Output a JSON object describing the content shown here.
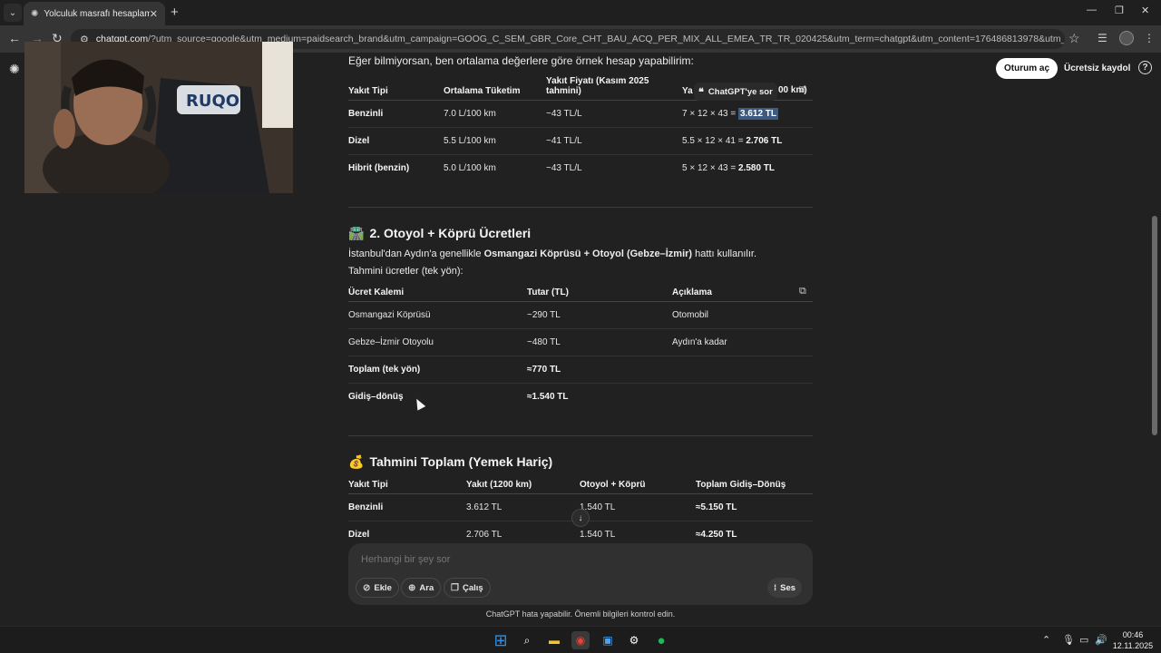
{
  "browser": {
    "tab_title": "Yolculuk masrafı hesaplama",
    "url_host": "chatgpt.com",
    "url_rest": "/?utm_source=google&utm_medium=paidsearch_brand&utm_campaign=GOOG_C_SEM_GBR_Core_CHT_BAU_ACQ_PER_MIX_ALL_EMEA_TR_TR_020425&utm_term=chatgpt&utm_content=176486813978&utm_ad=742246137488&utm_match=e..."
  },
  "header": {
    "login_label": "Oturum aç",
    "signup_label": "Ücretsiz kaydol"
  },
  "chat": {
    "intro": "Eğer bilmiyorsan, ben ortalama değerlere göre örnek hesap yapabilirim:",
    "ask_popup": "ChatGPT'ye sor",
    "ask_popup_icon": "quote-icon",
    "fuel_table": {
      "headers": [
        "Yakıt Tipi",
        "Ortalama Tüketim",
        "Yakıt Fiyatı (Kasım 2025 tahmini)",
        "Ya"
      ],
      "header_tail": "00 km)",
      "rows": [
        {
          "type": "Benzinli",
          "consumption": "7.0 L/100 km",
          "price": "~43 TL/L",
          "calc": "7 × 12 × 43 = ",
          "result": "3.612 TL"
        },
        {
          "type": "Dizel",
          "consumption": "5.5 L/100 km",
          "price": "~41 TL/L",
          "calc": "5.5 × 12 × 41 = ",
          "result": "2.706 TL"
        },
        {
          "type": "Hibrit (benzin)",
          "consumption": "5.0 L/100 km",
          "price": "~43 TL/L",
          "calc": "5 × 12 × 43 = ",
          "result": "2.580 TL"
        }
      ]
    },
    "section2": {
      "emoji": "🛣️",
      "title": "2. Otoyol + Köprü Ücretleri",
      "para1_start": "İstanbul'dan Aydın'a genellikle ",
      "para1_bold": "Osmangazi Köprüsü + Otoyol (Gebze–İzmir)",
      "para1_end": " hattı kullanılır.",
      "para2": "Tahmini ücretler (tek yön):",
      "headers": [
        "Ücret Kalemi",
        "Tutar (TL)",
        "Açıklama"
      ],
      "rows": [
        {
          "item": "Osmangazi Köprüsü",
          "amount": "~290 TL",
          "note": "Otomobil"
        },
        {
          "item": "Gebze–İzmir Otoyolu",
          "amount": "~480 TL",
          "note": "Aydın'a kadar"
        },
        {
          "item": "Toplam (tek yön)",
          "amount": "≈770 TL",
          "note": ""
        },
        {
          "item": "Gidiş–dönüş",
          "amount": "≈1.540 TL",
          "note": ""
        }
      ]
    },
    "section3": {
      "emoji": "💰",
      "title": "Tahmini Toplam (Yemek Hariç)",
      "headers": [
        "Yakıt Tipi",
        "Yakıt (1200 km)",
        "Otoyol + Köprü",
        "Toplam Gidiş–Dönüş"
      ],
      "rows": [
        {
          "type": "Benzinli",
          "fuel": "3.612 TL",
          "toll": "1.540 TL",
          "total": "≈5.150 TL"
        },
        {
          "type": "Dizel",
          "fuel": "2.706 TL",
          "toll": "1.540 TL",
          "total": "≈4.250 TL"
        }
      ]
    }
  },
  "composer": {
    "placeholder": "Herhangi bir şey sor",
    "attach_label": "Ekle",
    "search_label": "Ara",
    "study_label": "Çalış",
    "voice_label": "Ses"
  },
  "disclaimer": "ChatGPT hata yapabilir. Önemli bilgileri kontrol edin.",
  "taskbar": {
    "time": "00:46",
    "date": "12.11.2025"
  },
  "colors": {
    "background": "#212121",
    "highlight": "#3d5a80",
    "spotify": "#1db954",
    "windows": "#2f8fe8"
  }
}
